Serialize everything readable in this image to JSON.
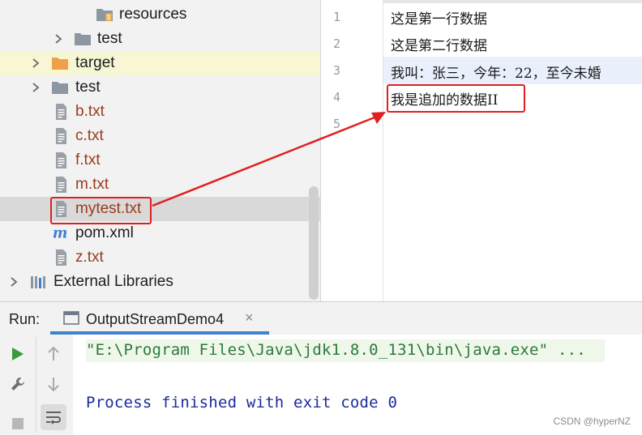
{
  "project_tree": {
    "rows": [
      {
        "label": "resources",
        "icon": "resources-folder-icon",
        "type": "folder",
        "expandable": false
      },
      {
        "label": "test",
        "icon": "folder-icon",
        "type": "folder",
        "expandable": true
      },
      {
        "label": "target",
        "icon": "folder-orange-icon",
        "type": "folder",
        "expandable": true
      },
      {
        "label": "test",
        "icon": "folder-icon",
        "type": "folder",
        "expandable": true
      },
      {
        "label": "b.txt",
        "icon": "text-file-icon",
        "type": "file"
      },
      {
        "label": "c.txt",
        "icon": "text-file-icon",
        "type": "file"
      },
      {
        "label": "f.txt",
        "icon": "text-file-icon",
        "type": "file"
      },
      {
        "label": "m.txt",
        "icon": "text-file-icon",
        "type": "file"
      },
      {
        "label": "mytest.txt",
        "icon": "text-file-icon",
        "type": "file",
        "selected": true
      },
      {
        "label": "pom.xml",
        "icon": "maven-icon",
        "type": "file"
      },
      {
        "label": "z.txt",
        "icon": "text-file-icon",
        "type": "file"
      },
      {
        "label": "External Libraries",
        "icon": "libraries-icon",
        "type": "group",
        "expandable": true
      }
    ]
  },
  "editor": {
    "line_numbers": [
      "1",
      "2",
      "3",
      "4",
      "5"
    ],
    "lines": [
      "这是第一行数据",
      "这是第二行数据",
      "我叫：张三，今年：22，至今未婚",
      "我是追加的数据II",
      ""
    ]
  },
  "run_panel": {
    "label": "Run:",
    "tab_title": "OutputStreamDemo4",
    "tab_close": "×",
    "command": "\"E:\\Program Files\\Java\\jdk1.8.0_131\\bin\\java.exe\" ...",
    "finish_message": "Process finished with exit code 0"
  },
  "watermark": "CSDN @hyperNZ",
  "colors": {
    "modified_file": "#9b3b1b",
    "highlight_box": "#e02020",
    "run_green": "#3c9a3c",
    "console_command": "#2b7a3b",
    "console_message": "#1b2b9a",
    "tab_underline": "#4083c9"
  }
}
